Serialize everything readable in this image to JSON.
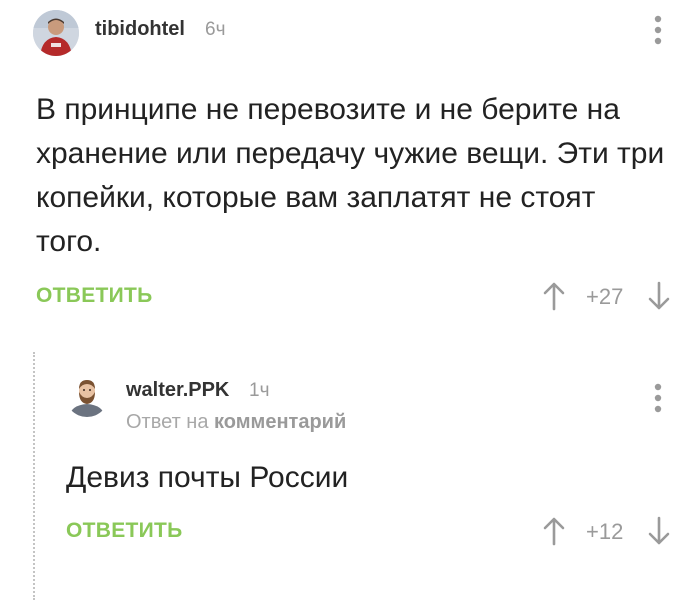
{
  "comments": [
    {
      "username": "tibidohtel",
      "time": "6ч",
      "body": "В принципе не перевозите и не берите на хранение или передачу чужие вещи. Эти три копейки, которые вам заплатят не стоят того.",
      "reply_label": "ОТВЕТИТЬ",
      "score": "+27",
      "avatar_icon": "user-photo-avatar",
      "menu_icon": "more-vertical-icon"
    },
    {
      "username": "walter.PPK",
      "time": "1ч",
      "reply_prefix": "Ответ на",
      "reply_target": "комментарий",
      "body": "Девиз почты России",
      "reply_label": "ОТВЕТИТЬ",
      "score": "+12",
      "avatar_icon": "bearded-man-avatar",
      "menu_icon": "more-vertical-icon"
    }
  ],
  "colors": {
    "accent_green": "#8ac858",
    "muted_gray": "#9a9a9a",
    "text": "#222222",
    "thread_line": "#c4c4c4"
  }
}
